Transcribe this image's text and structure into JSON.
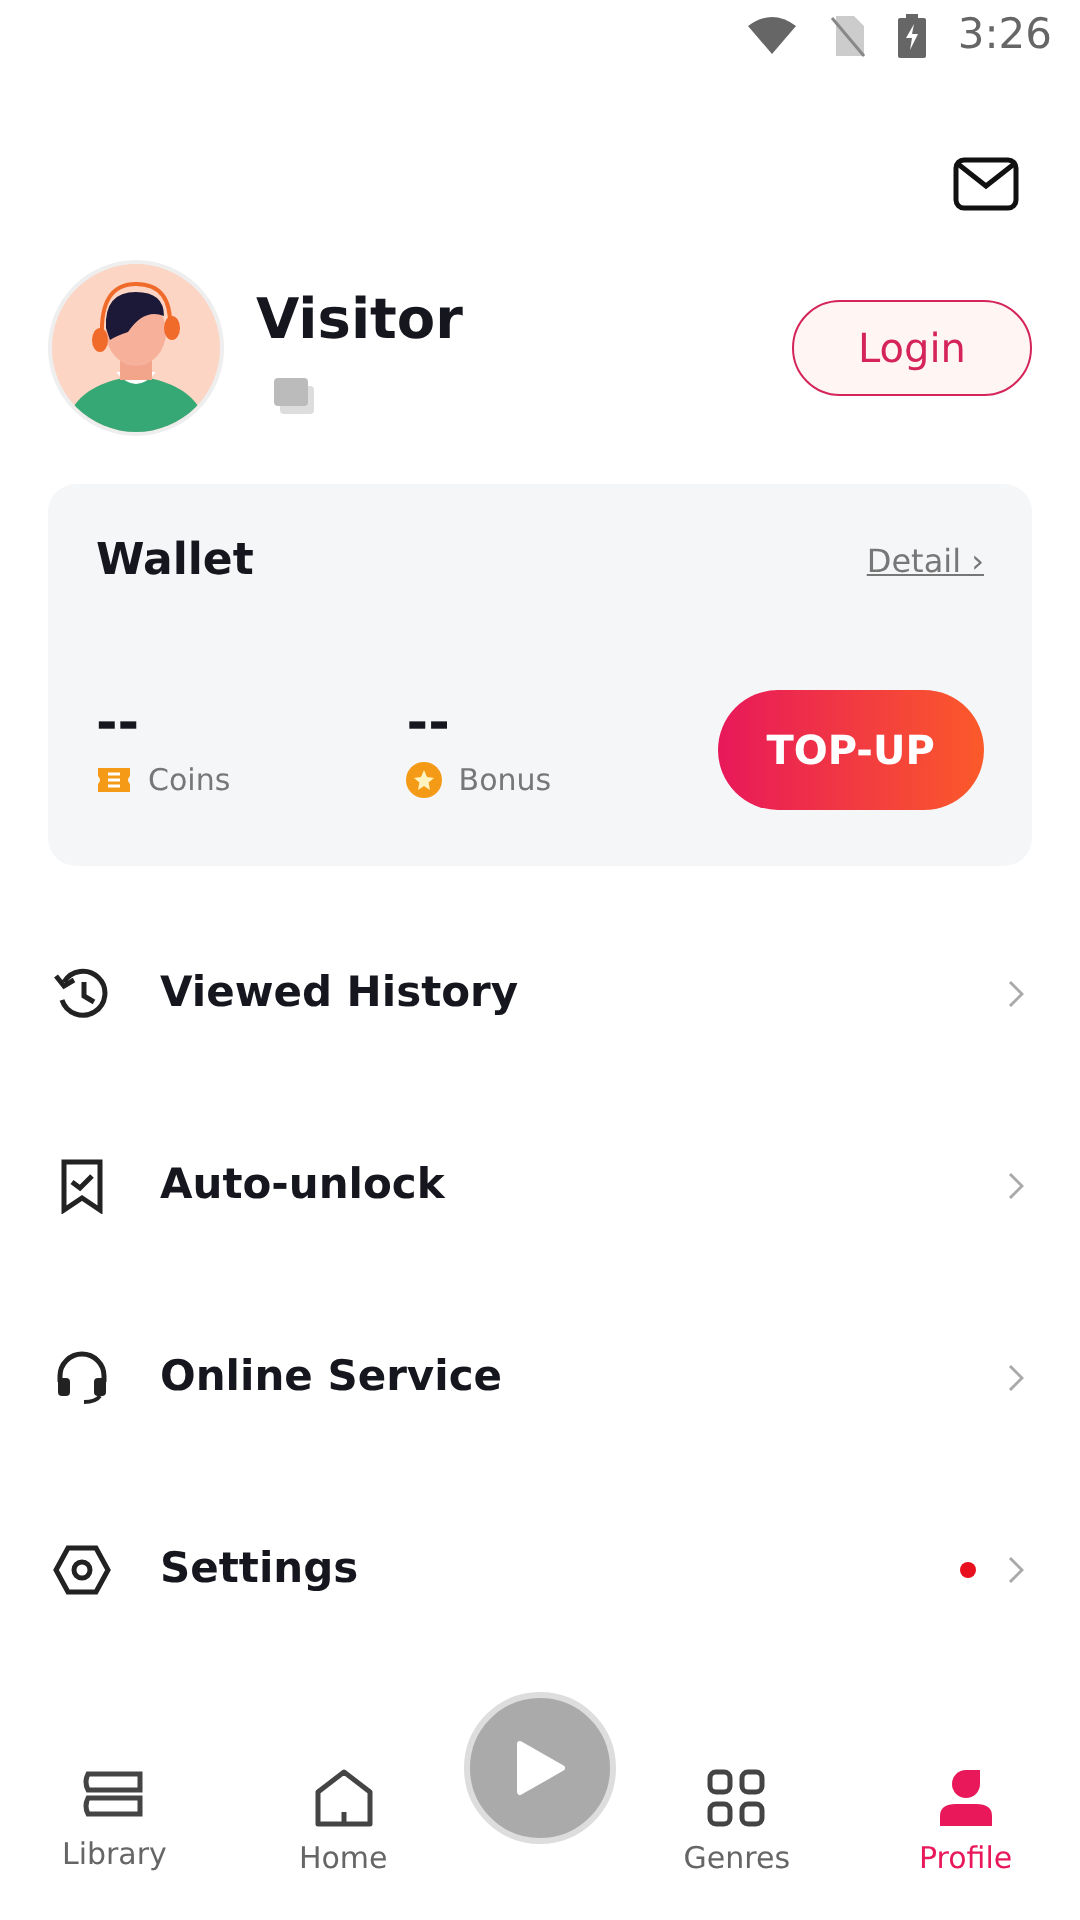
{
  "status_bar": {
    "time": "3:26"
  },
  "profile": {
    "name": "Visitor",
    "login_button": "Login"
  },
  "wallet": {
    "title": "Wallet",
    "detail_link": "Detail ›",
    "top_up_button": "TOP-UP",
    "balances": [
      {
        "kind": "coins",
        "value": "--",
        "label": "Coins"
      },
      {
        "kind": "bonus",
        "value": "--",
        "label": "Bonus"
      }
    ]
  },
  "menu": [
    {
      "kind": "history",
      "label": "Viewed History",
      "dot": false
    },
    {
      "kind": "unlock",
      "label": "Auto-unlock",
      "dot": false
    },
    {
      "kind": "service",
      "label": "Online Service",
      "dot": false
    },
    {
      "kind": "settings",
      "label": "Settings",
      "dot": true
    }
  ],
  "bottom_nav": [
    {
      "kind": "library",
      "label": "Library",
      "selected": false
    },
    {
      "kind": "home",
      "label": "Home",
      "selected": false
    },
    {
      "kind": "play",
      "selected": false
    },
    {
      "kind": "genres",
      "label": "Genres",
      "selected": false
    },
    {
      "kind": "profile",
      "label": "Profile",
      "selected": true
    }
  ]
}
